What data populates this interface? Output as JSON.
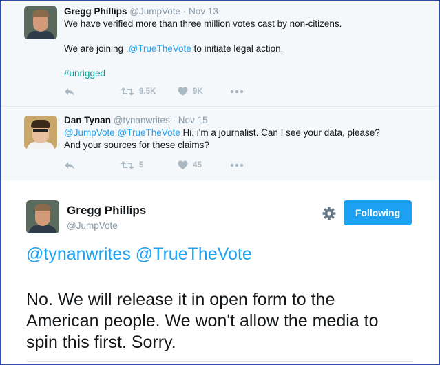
{
  "tweets": [
    {
      "name": "Gregg Phillips",
      "handle": "@JumpVote",
      "date": "Nov 13",
      "line1": "We have verified more than three million votes cast by non-citizens.",
      "line2_pre": "We are joining .",
      "line2_link": "@TrueTheVote",
      "line2_post": " to initiate legal action.",
      "hashtag": "#unrigged",
      "retweets": "9.5K",
      "likes": "9K"
    },
    {
      "name": "Dan Tynan",
      "handle": "@tynanwrites",
      "date": "Nov 15",
      "mention1": "@JumpVote",
      "mention2": "@TrueTheVote",
      "text1": " Hi. i'm a journalist. Can I see your data, please?",
      "text2": "And your sources for these claims?",
      "retweets": "5",
      "likes": "45"
    }
  ],
  "main": {
    "name": "Gregg Phillips",
    "handle": "@JumpVote",
    "follow_label": "Following",
    "mentions": "@tynanwrites @TrueTheVote",
    "line1": "No. We will release it in open form to the",
    "line2": "American people. We won't allow the media to",
    "line3": "spin this first. Sorry."
  },
  "icons": {
    "reply": "reply-icon",
    "retweet": "retweet-icon",
    "like": "heart-icon",
    "more": "more-icon",
    "settings": "gear-icon"
  },
  "colors": {
    "accent": "#1da1f2",
    "hashtag": "#00a398",
    "muted": "#8899a6"
  }
}
